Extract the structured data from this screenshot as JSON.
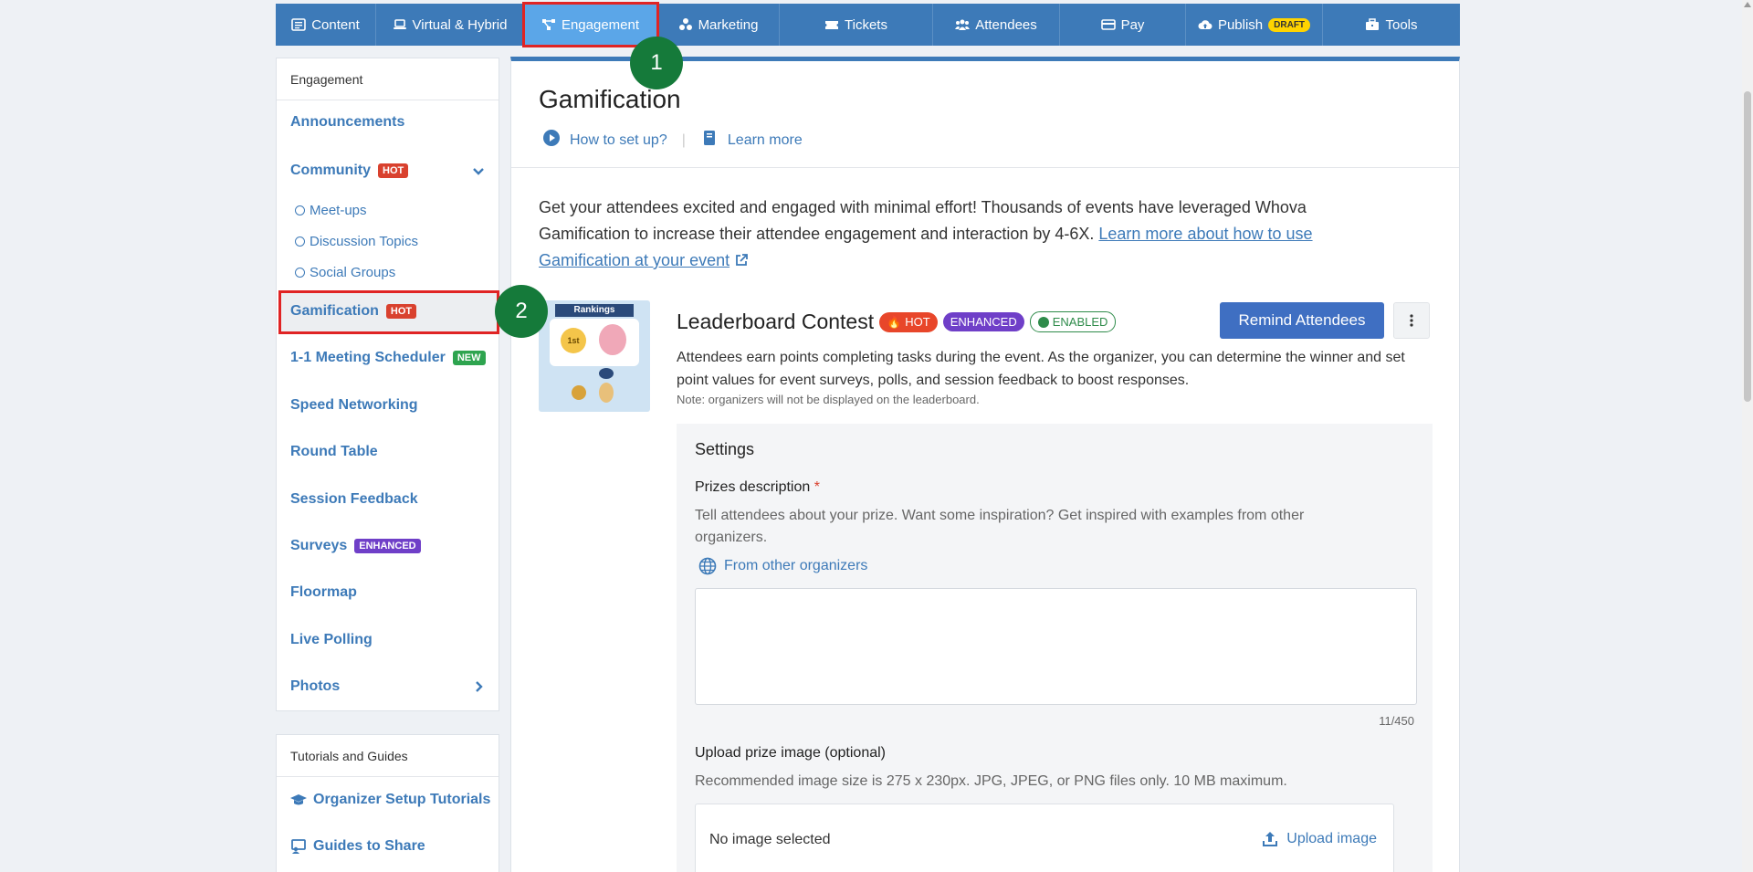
{
  "nav": {
    "items": [
      {
        "label": "Content",
        "icon": "list-icon"
      },
      {
        "label": "Virtual & Hybrid",
        "icon": "laptop-icon"
      },
      {
        "label": "Engagement",
        "icon": "nodes-icon"
      },
      {
        "label": "Marketing",
        "icon": "share-icon"
      },
      {
        "label": "Tickets",
        "icon": "ticket-icon"
      },
      {
        "label": "Attendees",
        "icon": "users-icon"
      },
      {
        "label": "Pay",
        "icon": "card-icon"
      },
      {
        "label": "Publish",
        "icon": "cloud-upload-icon",
        "badge": "DRAFT"
      },
      {
        "label": "Tools",
        "icon": "toolbox-icon"
      }
    ],
    "active": "Engagement"
  },
  "steps": {
    "one": "1",
    "two": "2"
  },
  "sidebar": {
    "header": "Engagement",
    "items": {
      "announcements": "Announcements",
      "community": "Community",
      "community_badge": "HOT",
      "meetups": "Meet-ups",
      "discussion": "Discussion Topics",
      "social": "Social Groups",
      "gamification": "Gamification",
      "gamification_badge": "HOT",
      "meeting": "1-1 Meeting Scheduler",
      "meeting_badge": "NEW",
      "speed": "Speed Networking",
      "round": "Round Table",
      "feedback": "Session Feedback",
      "surveys": "Surveys",
      "surveys_badge": "ENHANCED",
      "floormap": "Floormap",
      "polling": "Live Polling",
      "photos": "Photos"
    }
  },
  "tutorials": {
    "header": "Tutorials and Guides",
    "setup": "Organizer Setup Tutorials",
    "guides": "Guides to Share"
  },
  "main": {
    "title": "Gamification",
    "how_to": "How to set up?",
    "learn_more": "Learn more",
    "intro": "Get your attendees excited and engaged with minimal effort! Thousands of events have leveraged Whova Gamification to increase their attendee engagement and interaction by 4-6X.",
    "intro_link": "Learn more about how to use Gamification at your event",
    "image_banner": "Rankings",
    "image_medal": "1st",
    "leaderboard": {
      "title": "Leaderboard Contest",
      "hot": "HOT",
      "enhanced": "ENHANCED",
      "enabled": "ENABLED",
      "remind": "Remind Attendees",
      "description": "Attendees earn points completing tasks during the event. As the organizer, you can determine the winner and set point values for event surveys, polls, and session feedback to boost responses.",
      "note": "Note: organizers will not be displayed on the leaderboard."
    },
    "settings": {
      "title": "Settings",
      "prize_label": "Prizes description",
      "required_mark": "*",
      "prize_help": "Tell attendees about your prize. Want some inspiration? Get inspired with examples from other organizers.",
      "other_orgs": "From other organizers",
      "prize_value": "",
      "counter": "11/450",
      "upload_label": "Upload prize image (optional)",
      "upload_help": "Recommended image size is 275 x 230px. JPG, JPEG, or PNG files only. 10 MB maximum.",
      "no_image": "No image selected",
      "upload_button": "Upload image"
    }
  },
  "colors": {
    "nav": "#3d7ab8",
    "nav_active": "#5ba6e8",
    "highlight": "#e02424",
    "step_circle": "#157a3a",
    "primary_button": "#3f6fc2"
  }
}
